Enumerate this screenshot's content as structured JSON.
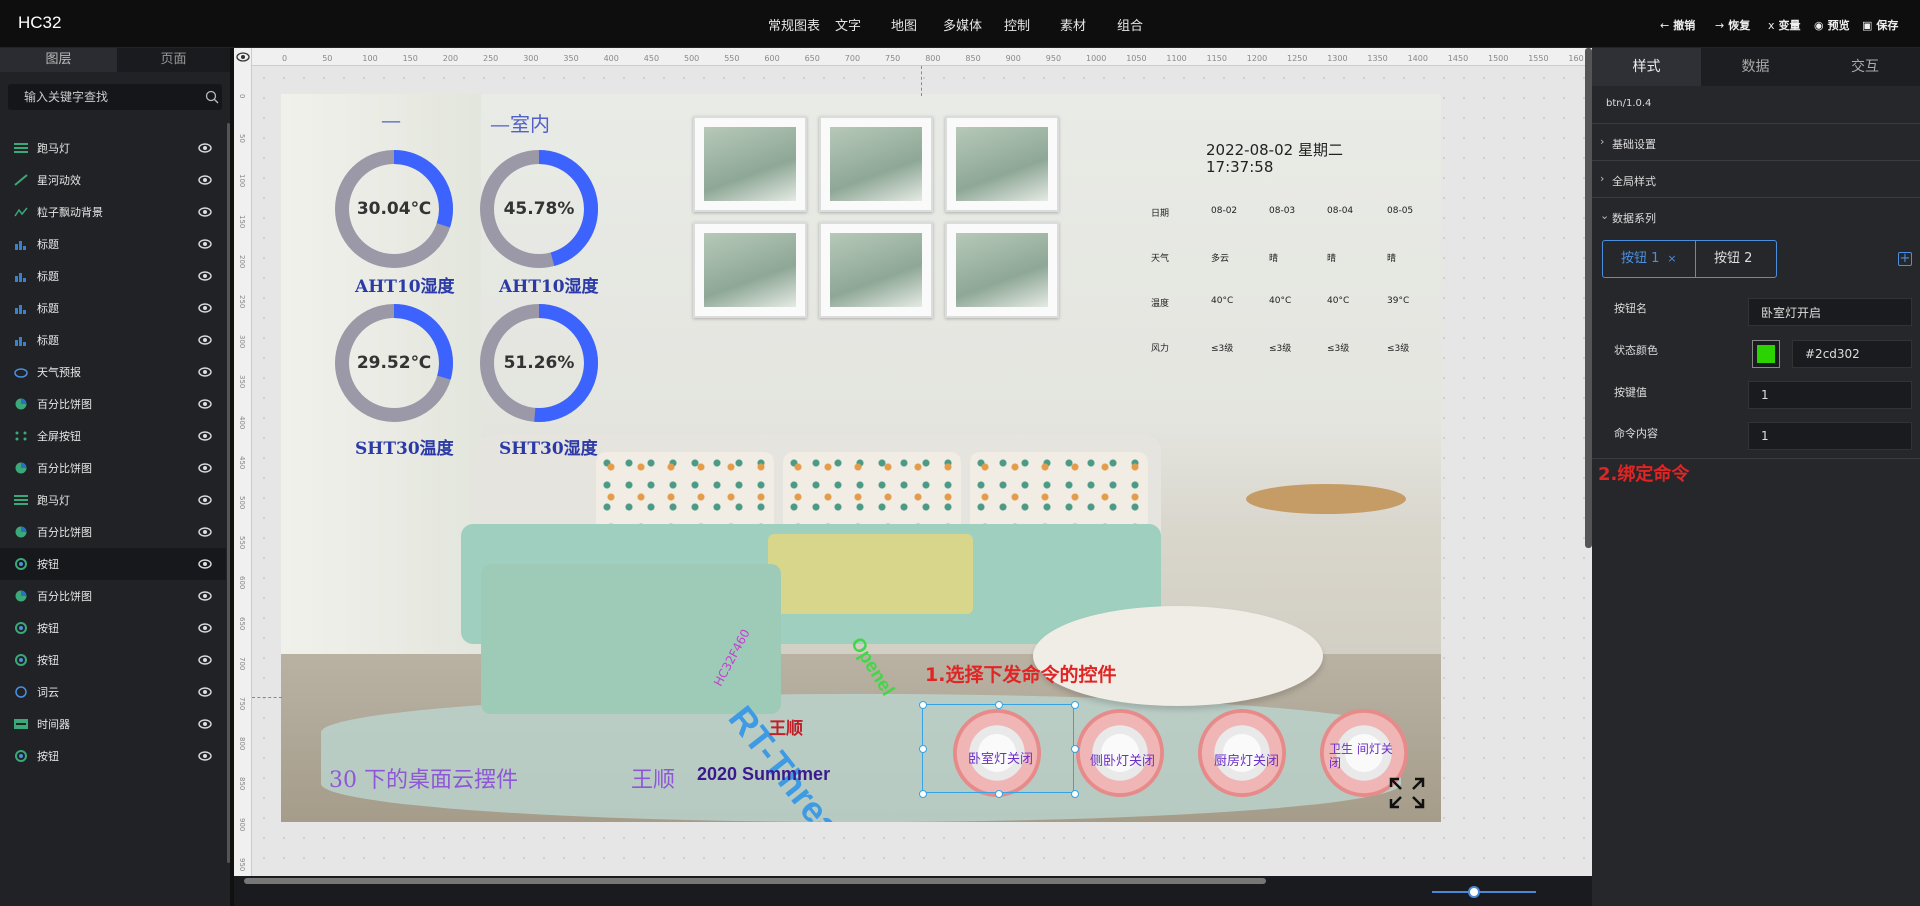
{
  "app": {
    "title": "HC32"
  },
  "top_nav": [
    "常规图表",
    "文字",
    "地图",
    "多媒体",
    "控制",
    "素材",
    "组合"
  ],
  "toolbar": {
    "undo": "撤销",
    "redo": "恢复",
    "variable": "变量",
    "preview": "预览",
    "save": "保存"
  },
  "left_panel": {
    "tabs": [
      "图层",
      "页面"
    ],
    "search_placeholder": "输入关键字查找",
    "layers": [
      {
        "name": "跑马灯",
        "icon": "marquee-icon"
      },
      {
        "name": "星河动效",
        "icon": "galaxy-icon"
      },
      {
        "name": "粒子飘动背景",
        "icon": "particles-icon"
      },
      {
        "name": "标题",
        "icon": "title-chart-icon"
      },
      {
        "name": "标题",
        "icon": "title-chart-icon"
      },
      {
        "name": "标题",
        "icon": "title-chart-icon"
      },
      {
        "name": "标题",
        "icon": "title-chart-icon"
      },
      {
        "name": "天气预报",
        "icon": "weather-icon"
      },
      {
        "name": "百分比饼图",
        "icon": "pie-icon"
      },
      {
        "name": "全屏按钮",
        "icon": "fullscreen-icon"
      },
      {
        "name": "百分比饼图",
        "icon": "pie-icon"
      },
      {
        "name": "跑马灯",
        "icon": "marquee-icon"
      },
      {
        "name": "百分比饼图",
        "icon": "pie-icon"
      },
      {
        "name": "按钮",
        "icon": "button-icon",
        "selected": true
      },
      {
        "name": "百分比饼图",
        "icon": "pie-icon"
      },
      {
        "name": "按钮",
        "icon": "button-icon"
      },
      {
        "name": "按钮",
        "icon": "button-icon"
      },
      {
        "name": "词云",
        "icon": "wordcloud-icon"
      },
      {
        "name": "时间器",
        "icon": "timer-icon"
      },
      {
        "name": "按钮",
        "icon": "button-icon"
      }
    ]
  },
  "ruler": {
    "h_ticks": [
      "0",
      "50",
      "100",
      "150",
      "200",
      "250",
      "300",
      "350",
      "400",
      "450",
      "500",
      "550",
      "600",
      "650",
      "700",
      "750",
      "800",
      "850",
      "900",
      "950",
      "1000",
      "1050",
      "1100",
      "1150",
      "1200",
      "1250",
      "1300",
      "1350",
      "1400",
      "1450",
      "1500",
      "1550",
      "160"
    ],
    "v_ticks": [
      "0",
      "50",
      "100",
      "150",
      "200",
      "250",
      "300",
      "350",
      "400",
      "450",
      "500",
      "550",
      "600",
      "650",
      "700",
      "750",
      "800",
      "850",
      "900",
      "950"
    ]
  },
  "canvas": {
    "gauges": [
      {
        "value": "30.04℃",
        "label": "AHT10湿度",
        "percent": 0.3004
      },
      {
        "value": "45.78%",
        "label": "AHT10湿度",
        "percent": 0.4578
      },
      {
        "value": "29.52℃",
        "label": "SHT30温度",
        "percent": 0.2952
      },
      {
        "value": "51.26%",
        "label": "SHT30湿度",
        "percent": 0.5126
      }
    ],
    "marquee_top": "—室内",
    "marquee_top_short": "—",
    "datetime": {
      "date": "2022-08-02 星期二",
      "time": "17:37:58"
    },
    "weather": {
      "rows": [
        [
          "日期",
          "08-02",
          "08-03",
          "08-04",
          "08-05"
        ],
        [
          "天气",
          "多云",
          "晴",
          "晴",
          "晴"
        ],
        [
          "温度",
          "40°C",
          "40°C",
          "40°C",
          "39°C"
        ],
        [
          "风力",
          "≤3级",
          "≤3级",
          "≤3级",
          "≤3级"
        ]
      ]
    },
    "wordcloud": {
      "rt_thread": "RT-Thread",
      "openel": "Openel",
      "hc32": "HC32F460",
      "wangshun": "王顺"
    },
    "marquee_bottom": "30  下的桌面云摆件",
    "marquee_bottom_2": "王顺",
    "summer": "2020 Summmer",
    "instruction_1": "1.选择下发命令的控件",
    "buttons": [
      {
        "label": "卧室灯关闭"
      },
      {
        "label": "侧卧灯关闭"
      },
      {
        "label": "厨房灯关闭"
      },
      {
        "label": "卫生 间灯关闭"
      }
    ]
  },
  "right_panel": {
    "tabs": [
      "样式",
      "数据",
      "交互"
    ],
    "version": "btn/1.0.4",
    "sections": [
      "基础设置",
      "全局样式",
      "数据系列"
    ],
    "series_tabs": [
      "按钮 1",
      "按钮 2"
    ],
    "form": {
      "name_label": "按钮名",
      "name_value": "卧室灯开启",
      "color_label": "状态颜色",
      "color_value": "#2cd302",
      "key_label": "按键值",
      "key_value": "1",
      "cmd_label": "命令内容",
      "cmd_value": "1"
    },
    "instruction_2": "2.绑定命令"
  },
  "colors": {
    "accent": "#4b8fe0",
    "gauge_fill": "#3d63ff",
    "gauge_track": "#9b98a8",
    "status": "#2cd302",
    "annotation": "#e02525"
  }
}
